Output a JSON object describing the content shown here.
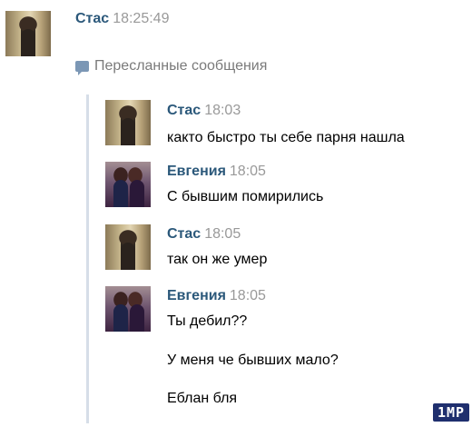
{
  "header_message": {
    "author": "Стас",
    "time": "18:25:49"
  },
  "forwarded": {
    "label": "Пересланные сообщения",
    "messages": [
      {
        "author": "Стас",
        "time": "18:03",
        "lines": [
          "както быстро ты себе парня нашла"
        ]
      },
      {
        "author": "Евгения",
        "time": "18:05",
        "lines": [
          "С бывшим помирились"
        ]
      },
      {
        "author": "Стас",
        "time": "18:05",
        "lines": [
          "так он же умер"
        ]
      },
      {
        "author": "Евгения",
        "time": "18:05",
        "lines": [
          "Ты дебил??",
          "У меня че бывших мало?",
          "Еблан бля"
        ]
      }
    ]
  },
  "watermark": "1MP"
}
